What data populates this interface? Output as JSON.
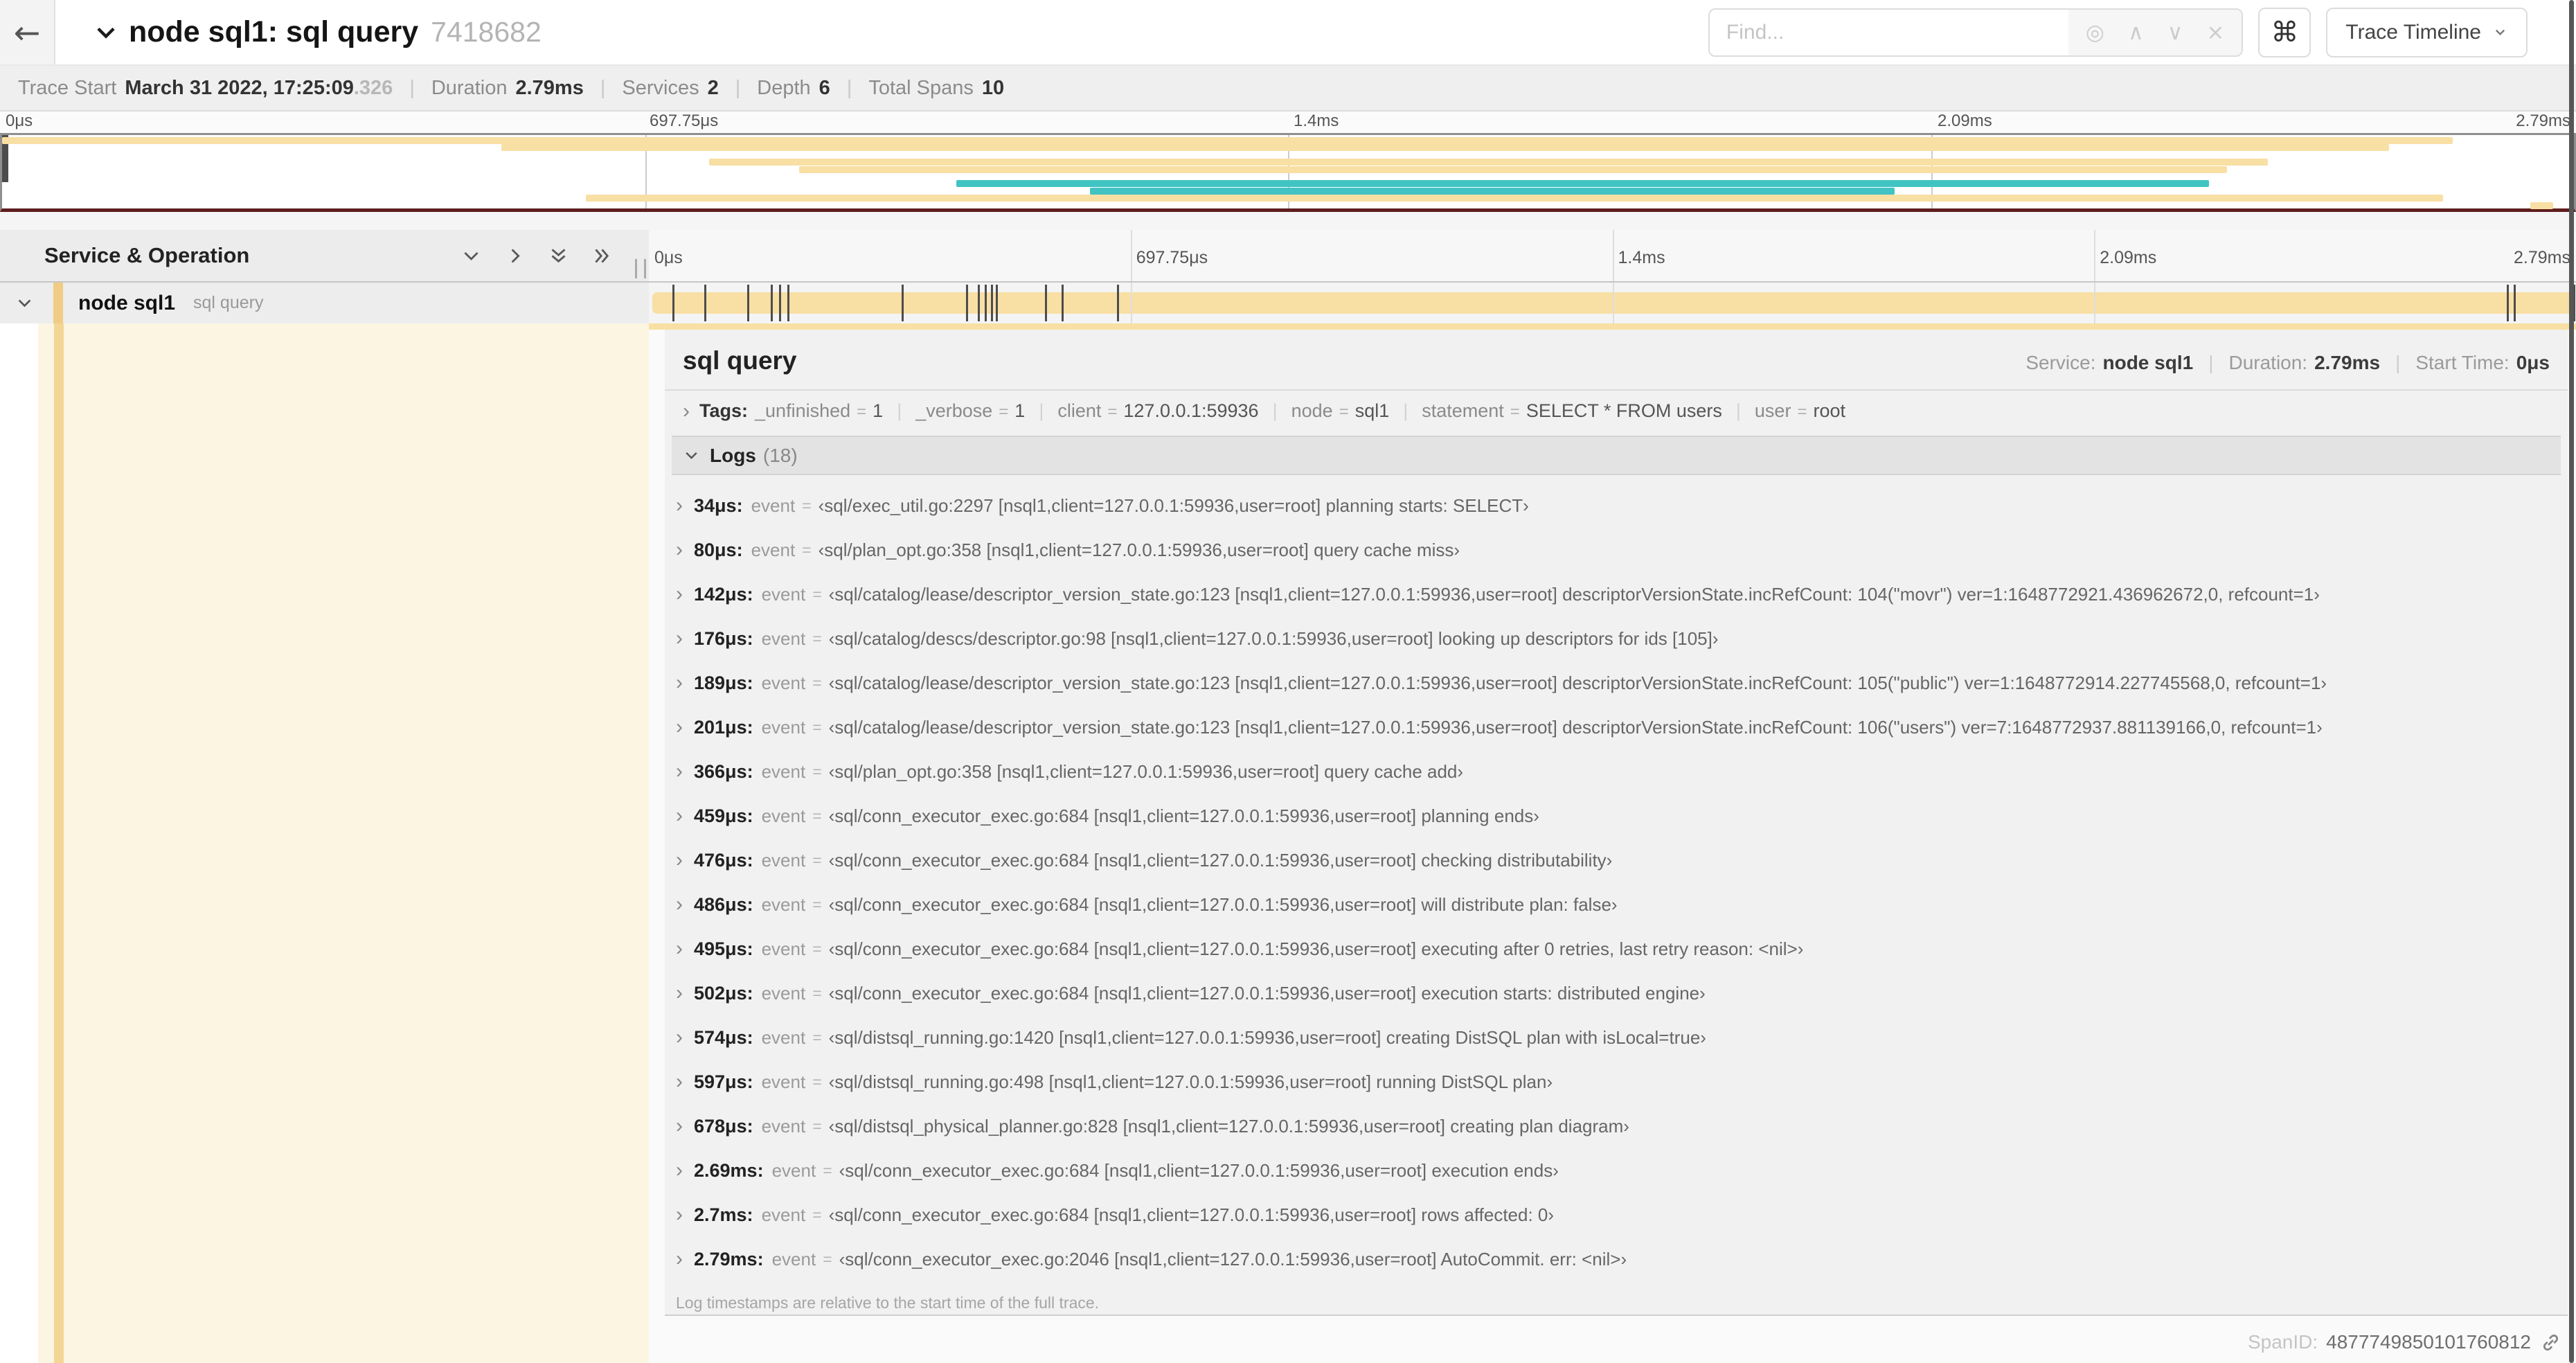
{
  "header": {
    "title": "node sql1: sql query",
    "trace_id": "7418682",
    "find_placeholder": "Find...",
    "keyboard_icon": "⌘",
    "view_selector": "Trace Timeline",
    "find_icons": [
      "◎",
      "∧",
      "∨",
      "×"
    ],
    "back_icon": "←"
  },
  "summary": {
    "items": [
      {
        "label": "Trace Start",
        "value": "March 31 2022, 17:25:09",
        "suffix": ".326"
      },
      {
        "label": "Duration",
        "value": "2.79ms"
      },
      {
        "label": "Services",
        "value": "2"
      },
      {
        "label": "Depth",
        "value": "6"
      },
      {
        "label": "Total Spans",
        "value": "10"
      }
    ]
  },
  "minimap": {
    "ticks": [
      {
        "label": "0μs",
        "pct": 0
      },
      {
        "label": "697.75μs",
        "pct": 25
      },
      {
        "label": "1.4ms",
        "pct": 50
      },
      {
        "label": "2.09ms",
        "pct": 75
      },
      {
        "label": "2.79ms",
        "pct": 100
      }
    ],
    "colors": {
      "span": "#f8dfa4",
      "highlight": "#41c3c3"
    },
    "bars": [
      {
        "row": 0,
        "start": 0,
        "end": 95.3,
        "color": "span"
      },
      {
        "row": 1,
        "start": 19.4,
        "end": 92.8,
        "color": "span"
      },
      {
        "row": 3,
        "start": 27.5,
        "end": 88.1,
        "color": "span"
      },
      {
        "row": 4,
        "start": 31.0,
        "end": 86.5,
        "color": "span"
      },
      {
        "row": 6,
        "start": 37.1,
        "end": 85.8,
        "color": "highlight"
      },
      {
        "row": 7,
        "start": 42.3,
        "end": 73.6,
        "color": "highlight"
      },
      {
        "row": 8,
        "start": 22.7,
        "end": 94.9,
        "color": "span"
      },
      {
        "row": 9,
        "start": 98.3,
        "end": 99.2,
        "color": "span"
      }
    ],
    "gridline_pcts": [
      25,
      50,
      75
    ]
  },
  "timeline": {
    "left_header": "Service & Operation",
    "ruler_ticks": [
      {
        "label": "0μs",
        "pct": 0
      },
      {
        "label": "697.75μs",
        "pct": 25
      },
      {
        "label": "1.4ms",
        "pct": 50
      },
      {
        "label": "2.09ms",
        "pct": 75
      },
      {
        "label": "2.79ms",
        "pct": 100
      }
    ],
    "gridline_pcts": [
      25,
      50,
      75
    ],
    "row": {
      "service": "node sql1",
      "operation": "sql query"
    }
  },
  "detail": {
    "operation": "sql query",
    "service_label": "Service:",
    "service": "node sql1",
    "duration_label": "Duration:",
    "duration": "2.79ms",
    "start_label": "Start Time:",
    "start": "0μs",
    "tags_label": "Tags:",
    "tags": [
      {
        "key": "_unfinished",
        "value": "1"
      },
      {
        "key": "_verbose",
        "value": "1"
      },
      {
        "key": "client",
        "value": "127.0.0.1:59936"
      },
      {
        "key": "node",
        "value": "sql1"
      },
      {
        "key": "statement",
        "value": "SELECT * FROM users"
      },
      {
        "key": "user",
        "value": "root"
      }
    ],
    "logs_label": "Logs",
    "logs_count": "(18)",
    "log_field_name": "event",
    "logs": [
      {
        "t": "34μs:",
        "pct": 1.22,
        "msg": "‹sql/exec_util.go:2297 [nsql1,client=127.0.0.1:59936,user=root] planning starts: SELECT›"
      },
      {
        "t": "80μs:",
        "pct": 2.87,
        "msg": "‹sql/plan_opt.go:358 [nsql1,client=127.0.0.1:59936,user=root] query cache miss›"
      },
      {
        "t": "142μs:",
        "pct": 5.09,
        "msg": "‹sql/catalog/lease/descriptor_version_state.go:123 [nsql1,client=127.0.0.1:59936,user=root] descriptorVersionState.incRefCount: 104(\"movr\") ver=1:1648772921.436962672,0, refcount=1›"
      },
      {
        "t": "176μs:",
        "pct": 6.31,
        "msg": "‹sql/catalog/descs/descriptor.go:98 [nsql1,client=127.0.0.1:59936,user=root] looking up descriptors for ids [105]›"
      },
      {
        "t": "189μs:",
        "pct": 6.77,
        "msg": "‹sql/catalog/lease/descriptor_version_state.go:123 [nsql1,client=127.0.0.1:59936,user=root] descriptorVersionState.incRefCount: 105(\"public\") ver=1:1648772914.227745568,0, refcount=1›"
      },
      {
        "t": "201μs:",
        "pct": 7.2,
        "msg": "‹sql/catalog/lease/descriptor_version_state.go:123 [nsql1,client=127.0.0.1:59936,user=root] descriptorVersionState.incRefCount: 106(\"users\") ver=7:1648772937.881139166,0, refcount=1›"
      },
      {
        "t": "366μs:",
        "pct": 13.12,
        "msg": "‹sql/plan_opt.go:358 [nsql1,client=127.0.0.1:59936,user=root] query cache add›"
      },
      {
        "t": "459μs:",
        "pct": 16.45,
        "msg": "‹sql/conn_executor_exec.go:684 [nsql1,client=127.0.0.1:59936,user=root] planning ends›"
      },
      {
        "t": "476μs:",
        "pct": 17.06,
        "msg": "‹sql/conn_executor_exec.go:684 [nsql1,client=127.0.0.1:59936,user=root] checking distributability›"
      },
      {
        "t": "486μs:",
        "pct": 17.42,
        "msg": "‹sql/conn_executor_exec.go:684 [nsql1,client=127.0.0.1:59936,user=root] will distribute plan: false›"
      },
      {
        "t": "495μs:",
        "pct": 17.74,
        "msg": "‹sql/conn_executor_exec.go:684 [nsql1,client=127.0.0.1:59936,user=root] executing after 0 retries, last retry reason: <nil>›"
      },
      {
        "t": "502μs:",
        "pct": 18.0,
        "msg": "‹sql/conn_executor_exec.go:684 [nsql1,client=127.0.0.1:59936,user=root] execution starts: distributed engine›"
      },
      {
        "t": "574μs:",
        "pct": 20.57,
        "msg": "‹sql/distsql_running.go:1420 [nsql1,client=127.0.0.1:59936,user=root] creating DistSQL plan with isLocal=true›"
      },
      {
        "t": "597μs:",
        "pct": 21.4,
        "msg": "‹sql/distsql_running.go:498 [nsql1,client=127.0.0.1:59936,user=root] running DistSQL plan›"
      },
      {
        "t": "678μs:",
        "pct": 24.3,
        "msg": "‹sql/distsql_physical_planner.go:828 [nsql1,client=127.0.0.1:59936,user=root] creating plan diagram›"
      },
      {
        "t": "2.69ms:",
        "pct": 96.42,
        "msg": "‹sql/conn_executor_exec.go:684 [nsql1,client=127.0.0.1:59936,user=root] execution ends›"
      },
      {
        "t": "2.7ms:",
        "pct": 96.77,
        "msg": "‹sql/conn_executor_exec.go:684 [nsql1,client=127.0.0.1:59936,user=root] rows affected: 0›"
      },
      {
        "t": "2.79ms:",
        "pct": 100,
        "msg": "‹sql/conn_executor_exec.go:2046 [nsql1,client=127.0.0.1:59936,user=root] AutoCommit. err: <nil>›"
      }
    ],
    "footer_note": "Log timestamps are relative to the start time of the full trace.",
    "span_id_label": "SpanID:",
    "span_id": "4877749850101760812"
  }
}
